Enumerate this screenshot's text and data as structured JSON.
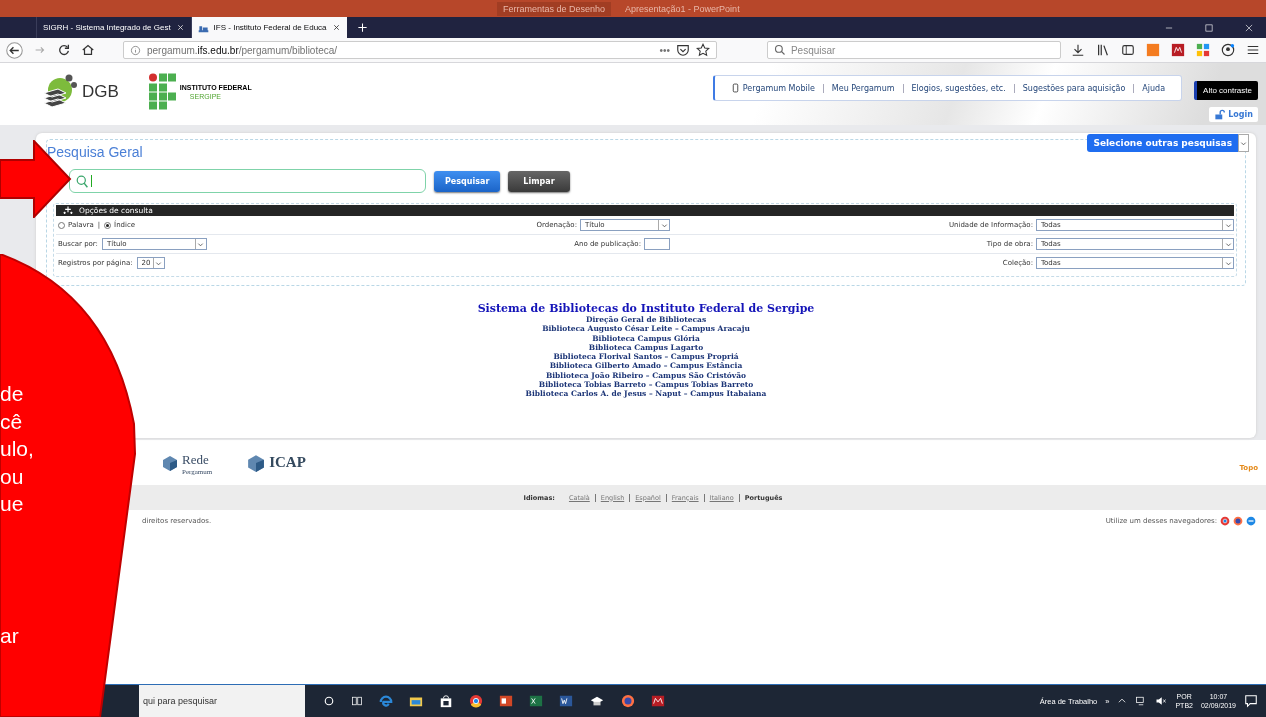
{
  "presentation_titlebar": {
    "context_tab": "Ferramentas de Desenho",
    "title": "Apresentação1 - PowerPoint"
  },
  "browser": {
    "tabs": [
      {
        "title": "SIGRH - Sistema Integrado de Gest",
        "selected": false
      },
      {
        "title": "IFS - Instituto Federal de Educa",
        "selected": true
      }
    ],
    "url": {
      "prefix": "pergamum.",
      "domain": "ifs.edu.br",
      "path": "/pergamum/biblioteca/"
    },
    "page_actions": "•••",
    "search": {
      "placeholder": "Pesquisar"
    }
  },
  "header": {
    "dgb_logo": "DGB",
    "institute": {
      "name": "INSTITUTO FEDERAL",
      "state": "SERGIPE"
    },
    "links": [
      "Pergamum Mobile",
      "Meu Pergamum",
      "Elogios, sugestões, etc.",
      "Sugestões para aquisição",
      "Ajuda"
    ],
    "high_contrast": "Alto contraste",
    "login": "Login"
  },
  "search": {
    "legend": "Pesquisa Geral",
    "other_searches": "Selecione outras pesquisas",
    "search_button": "Pesquisar",
    "clear_button": "Limpar",
    "options_title": "Opções de consulta",
    "modes": [
      {
        "label": "Palavra",
        "selected": false
      },
      {
        "label": "Índice",
        "selected": true
      }
    ],
    "mode_separator": "|",
    "rows": [
      {
        "left": {
          "kind": "radios"
        },
        "middle": {
          "label": "Ordenação:",
          "value": "Título",
          "kind": "select"
        },
        "right": {
          "label": "Unidade de Informação:",
          "value": "Todas"
        }
      },
      {
        "left": {
          "kind": "select",
          "label": "Buscar por:",
          "value": "Título"
        },
        "middle": {
          "label": "Ano de publicação:",
          "kind": "input"
        },
        "right": {
          "label": "Tipo de obra:",
          "value": "Todas"
        }
      },
      {
        "left": {
          "kind": "small-select",
          "label": "Registros por página:",
          "value": "20"
        },
        "right": {
          "label": "Coleção:",
          "value": "Todas"
        }
      }
    ]
  },
  "libraries": {
    "title": "Sistema de Bibliotecas do Instituto Federal de Sergipe",
    "items": [
      "Direção Geral de Bibliotecas",
      "Biblioteca Augusto César Leite – Campus Aracaju",
      "Biblioteca Campus Glória",
      "Biblioteca Campus Lagarto",
      "Biblioteca Florival Santos – Campus Propriá",
      "Biblioteca Gilberto Amado – Campus Estância",
      "Biblioteca João Ribeiro – Campus São Cristóvão",
      "Biblioteca Tobias Barreto – Campus Tobias Barreto",
      "Biblioteca Carlos A. de Jesus – Naput – Campus Itabaiana"
    ]
  },
  "footer": {
    "partners": [
      {
        "name": "Rede",
        "sub": "Pergamum"
      },
      {
        "name": "ICAP"
      }
    ],
    "top_link": "Topo",
    "languages_label": "Idiomas:",
    "languages": [
      {
        "label": "Català",
        "selected": false
      },
      {
        "label": "English",
        "selected": false
      },
      {
        "label": "Español",
        "selected": false
      },
      {
        "label": "Français",
        "selected": false
      },
      {
        "label": "Italiano",
        "selected": false
      },
      {
        "label": "Português",
        "selected": true
      }
    ],
    "copyright": "direitos reservados.",
    "browsers_hint": "Utilize um desses navegadores:"
  },
  "taskbar": {
    "search_placeholder": "qui para pesquisar",
    "desktop_label": "Área de Trabalho",
    "overflow": "»",
    "language": "POR",
    "layout": "PTB2",
    "time": "10:07",
    "date": "02/09/2019"
  },
  "callout": {
    "lines": [
      "de",
      "cê",
      "ulo,",
      "ou",
      "ue",
      "ar"
    ]
  }
}
